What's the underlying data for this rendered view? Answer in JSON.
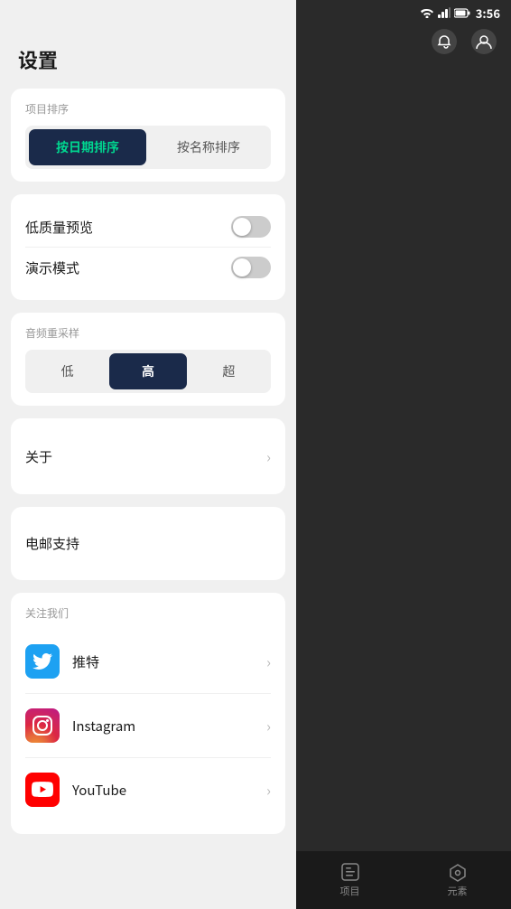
{
  "statusBar": {
    "time": "3:56",
    "icons": [
      "wifi",
      "signal",
      "battery"
    ]
  },
  "settings": {
    "pageTitle": "设置",
    "sortSection": {
      "label": "项目排序",
      "btn1": "按日期排序",
      "btn2": "按名称排序",
      "activeIndex": 0
    },
    "toggleSection": {
      "items": [
        {
          "label": "低质量预览",
          "enabled": false
        },
        {
          "label": "演示模式",
          "enabled": false
        }
      ]
    },
    "resampleSection": {
      "label": "音频重采样",
      "options": [
        "低",
        "高",
        "超"
      ],
      "activeIndex": 1
    },
    "aboutItem": {
      "label": "关于"
    },
    "emailItem": {
      "label": "电邮支持"
    },
    "followSection": {
      "label": "关注我们",
      "items": [
        {
          "name": "twitter",
          "label": "推特"
        },
        {
          "name": "instagram",
          "label": "Instagram"
        },
        {
          "name": "youtube",
          "label": "YouTube"
        }
      ]
    }
  },
  "bottomNav": {
    "items": [
      {
        "icon": "📁",
        "label": "项目"
      },
      {
        "icon": "✦",
        "label": "元素"
      }
    ]
  }
}
